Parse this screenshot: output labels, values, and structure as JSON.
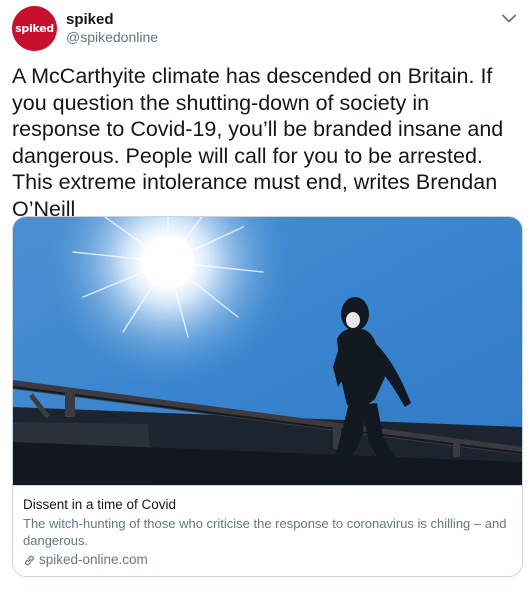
{
  "account": {
    "avatar_text": "spiked",
    "avatar_color": "#c8102e",
    "name": "spiked",
    "handle": "@spikedonline"
  },
  "tweet": {
    "text": "A McCarthyite climate has descended on Britain. If you question the shutting-down of society in response to Covid-19, you’ll be branded insane and dangerous. People will call for you to be arrested. This extreme intolerance must end, writes Brendan O’Neill"
  },
  "card": {
    "title": "Dissent in a time of Covid",
    "description": "The witch-hunting of those who criticise the response to coronavirus is chilling – and dangerous.",
    "domain": "spiked-online.com",
    "image_icon": "man-in-mask-walking-photo"
  },
  "icons": {
    "menu": "chevron-down-icon",
    "link": "link-icon"
  },
  "colors": {
    "text": "#14171a",
    "secondary": "#657786",
    "border": "#ccd6dd",
    "sky": "#3a86cf"
  }
}
